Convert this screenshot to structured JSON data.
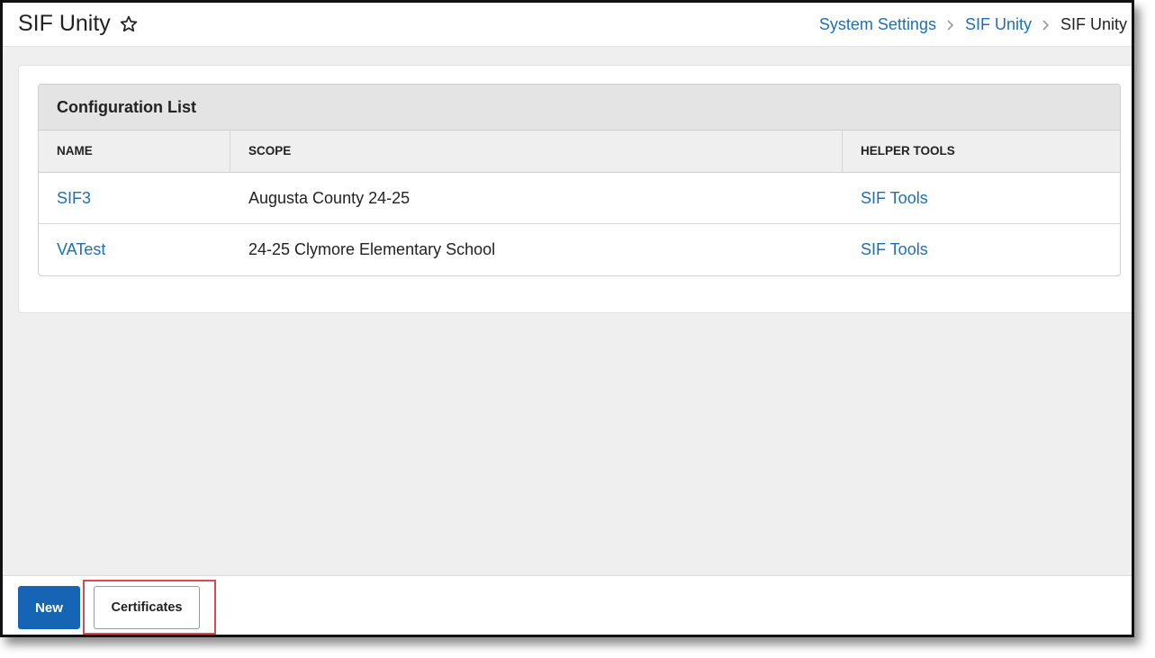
{
  "header": {
    "title": "SIF Unity",
    "favorite_icon": "star-icon",
    "breadcrumb": [
      {
        "label": "System Settings"
      },
      {
        "label": "SIF Unity"
      },
      {
        "label": "SIF Unity"
      }
    ]
  },
  "table": {
    "title": "Configuration List",
    "columns": [
      "NAME",
      "SCOPE",
      "HELPER TOOLS"
    ],
    "rows": [
      {
        "name": "SIF3",
        "scope": "Augusta County 24-25",
        "tools": "SIF Tools"
      },
      {
        "name": "VATest",
        "scope": "24-25 Clymore Elementary School",
        "tools": "SIF Tools"
      }
    ]
  },
  "footer": {
    "new_label": "New",
    "certificates_label": "Certificates"
  },
  "colors": {
    "link": "#1f6fb5",
    "primary_button": "#1565b4",
    "highlight": "#e0474f"
  }
}
